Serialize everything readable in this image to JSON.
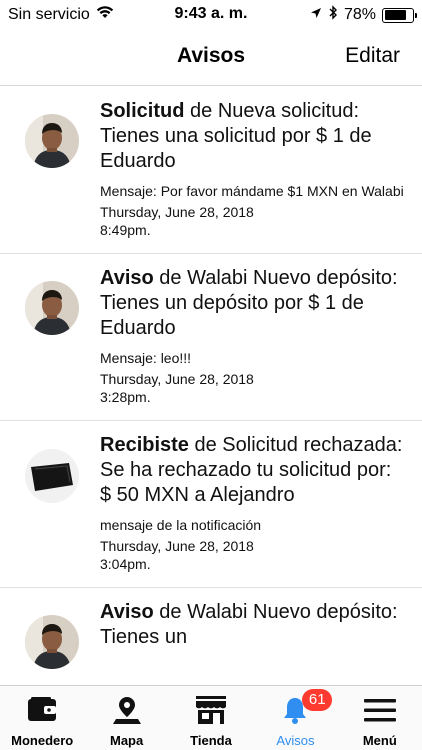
{
  "status_bar": {
    "carrier": "Sin servicio",
    "time": "9:43 a. m.",
    "battery_percent": "78%",
    "battery_level": 0.78
  },
  "nav": {
    "title": "Avisos",
    "edit_label": "Editar"
  },
  "notifications": [
    {
      "type": "Solicitud",
      "title_rest": " de Nueva solicitud: Tienes una solicitud por $ 1 de Eduardo",
      "message": "Mensaje: Por favor mándame $1 MXN en Walabi",
      "date": "Thursday, June 28, 2018",
      "time": "8:49pm.",
      "avatar": "person-avatar"
    },
    {
      "type": "Aviso",
      "title_rest": " de Walabi Nuevo depósito: Tienes un depósito por $ 1 de Eduardo",
      "message": "Mensaje: leo!!!",
      "date": "Thursday, June 28, 2018",
      "time": "3:28pm.",
      "avatar": "person-avatar"
    },
    {
      "type": "Recibiste",
      "title_rest": " de Solicitud rechazada: Se ha rechazado tu solicitud por: $ 50 MXN a Alejandro",
      "message": "mensaje de la notificación",
      "date": "Thursday, June 28, 2018",
      "time": "3:04pm.",
      "avatar": "wallet-avatar"
    },
    {
      "type": "Aviso",
      "title_rest": " de Walabi Nuevo depósito: Tienes un",
      "message": "",
      "date": "",
      "time": "",
      "avatar": "person-avatar"
    }
  ],
  "tabs": [
    {
      "label": "Monedero",
      "icon": "wallet-icon"
    },
    {
      "label": "Mapa",
      "icon": "map-pin-icon"
    },
    {
      "label": "Tienda",
      "icon": "store-icon"
    },
    {
      "label": "Avisos",
      "icon": "bell-icon",
      "badge": "61",
      "active": true
    },
    {
      "label": "Menú",
      "icon": "hamburger-menu-icon"
    }
  ],
  "colors": {
    "accent": "#2f8ef0",
    "badge": "#ff3b30"
  }
}
